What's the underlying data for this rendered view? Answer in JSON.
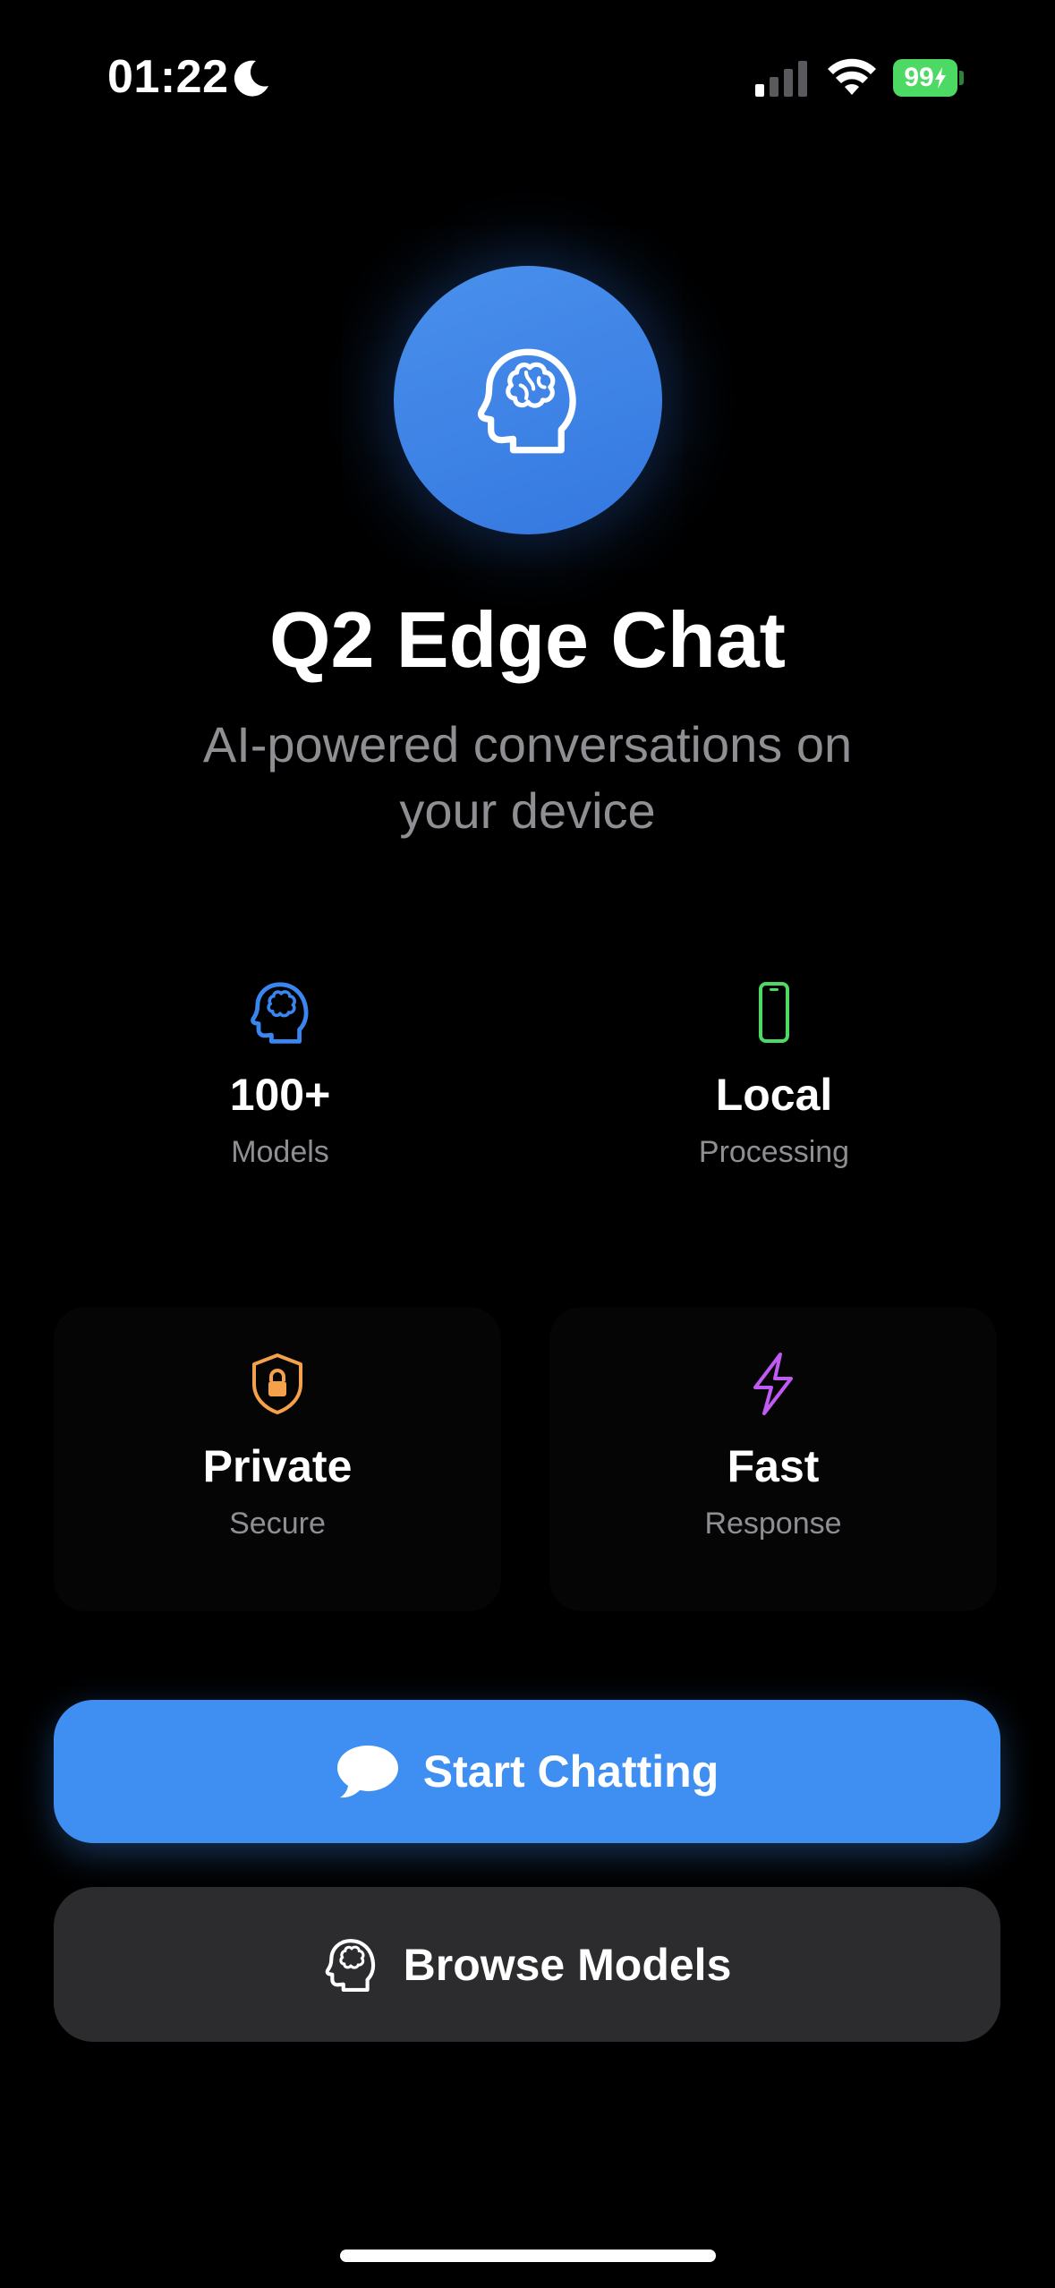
{
  "status_bar": {
    "time": "01:22",
    "battery_level": "99",
    "icons": [
      "moon-icon",
      "cellular-signal-icon",
      "wifi-icon",
      "battery-charging-icon"
    ]
  },
  "hero": {
    "logo_icon": "brain-head-icon",
    "title": "Q2 Edge Chat",
    "subtitle": "AI-powered conversations on your device"
  },
  "features": [
    {
      "icon": "brain-head-icon",
      "value": "100+",
      "label": "Models",
      "color": "#3a86f0"
    },
    {
      "icon": "smartphone-icon",
      "value": "Local",
      "label": "Processing",
      "color": "#4cd964"
    },
    {
      "icon": "shield-lock-icon",
      "value": "Private",
      "label": "Secure",
      "color": "#f5a04a"
    },
    {
      "icon": "bolt-icon",
      "value": "Fast",
      "label": "Response",
      "color": "#bf5af2"
    }
  ],
  "actions": {
    "primary": {
      "label": "Start Chatting",
      "icon": "chat-bubble-icon"
    },
    "secondary": {
      "label": "Browse Models",
      "icon": "brain-head-icon"
    }
  },
  "colors": {
    "background": "#000000",
    "accent": "#3f8ef2",
    "secondary_button": "#2c2c2e",
    "muted_text": "#8e8e93"
  }
}
